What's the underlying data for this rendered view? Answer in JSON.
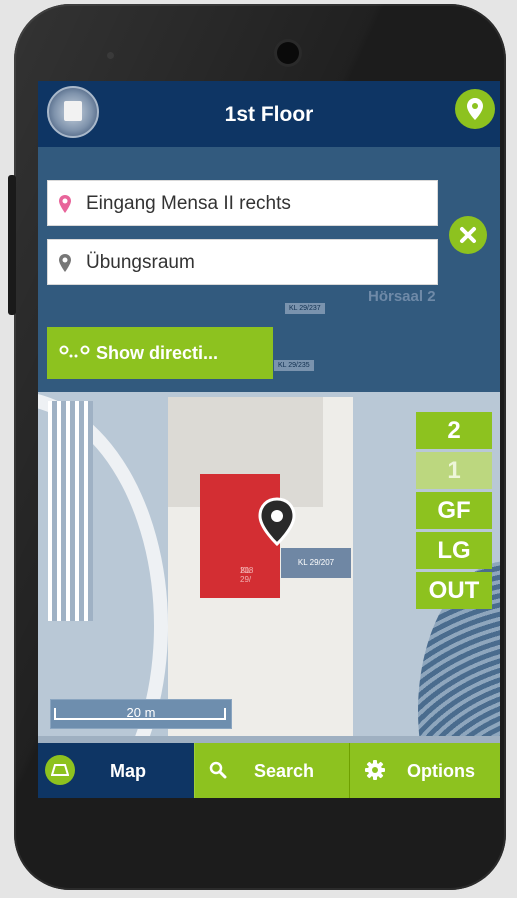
{
  "header": {
    "title": "1st Floor",
    "logo": "university-seal-logo",
    "locate_icon": "location-pin-icon"
  },
  "route": {
    "from": "Eingang Mensa II rechts",
    "to": "Übungsraum",
    "from_icon": "start-pin-icon",
    "to_icon": "destination-pin-icon",
    "clear_icon": "close-icon"
  },
  "directions_button": {
    "label": "Show directi..."
  },
  "map_labels": {
    "horsaal": "Hörsaal 2",
    "room_blue": "KL 29/207",
    "room_red_1": "KL 29/",
    "room_red_2": "208",
    "room_top_1": "KL 29/237",
    "room_top_2": "KL 29/235"
  },
  "floors": [
    {
      "label": "2",
      "active": false
    },
    {
      "label": "1",
      "active": true
    },
    {
      "label": "GF",
      "active": false
    },
    {
      "label": "LG",
      "active": false
    },
    {
      "label": "OUT",
      "active": false
    }
  ],
  "scale": {
    "label": "20 m"
  },
  "tabs": {
    "map": "Map",
    "search": "Search",
    "options": "Options"
  },
  "colors": {
    "navy": "#0e3564",
    "green": "#8dc21f",
    "room_highlight": "#d32e33"
  }
}
